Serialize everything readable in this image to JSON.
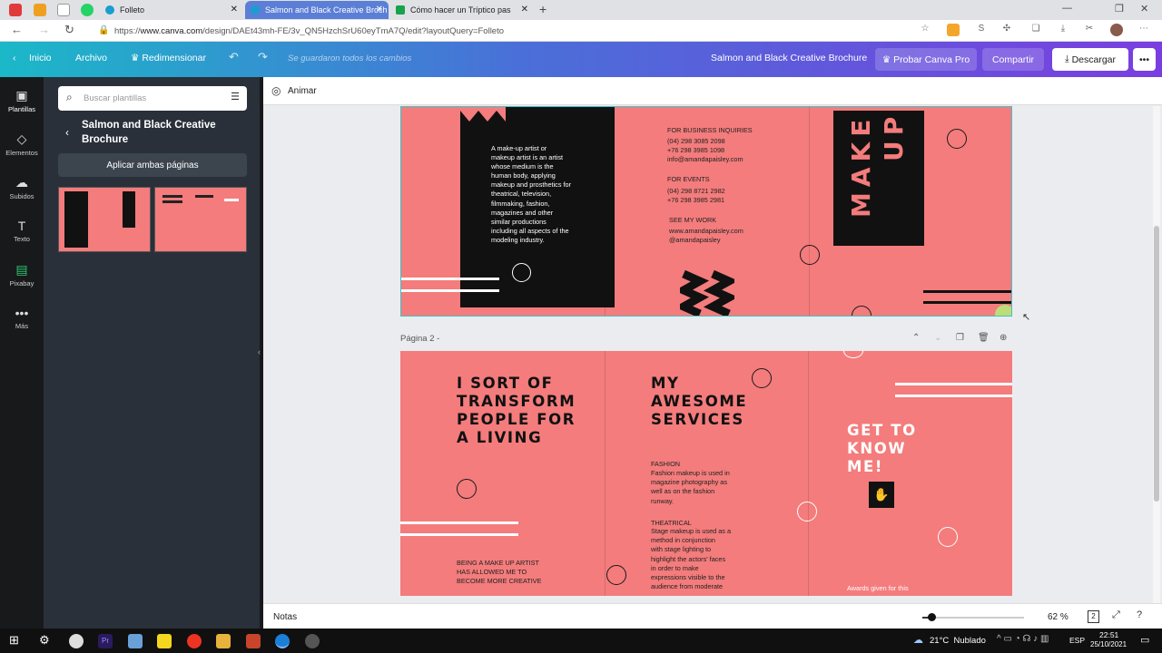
{
  "browser": {
    "tabs": [
      {
        "title": "Folleto",
        "active": false
      },
      {
        "title": "Salmon and Black Creative Broch",
        "active": true
      },
      {
        "title": "Cómo hacer un Tríptico pas",
        "active": false
      }
    ],
    "url_prefix": "https://",
    "url_domain": "www.canva.com",
    "url_path": "/design/DAEt43mh-FE/3v_QN5HzchSrU60eyTmA7Q/edit?layoutQuery=Folleto"
  },
  "canva_header": {
    "home": "Inicio",
    "file": "Archivo",
    "resize": "Redimensionar",
    "saved_status": "Se guardaron todos los cambios",
    "design_title": "Salmon and Black Creative Brochure",
    "try_pro": "Probar Canva Pro",
    "share": "Compartir",
    "download": "Descargar",
    "more": "•••"
  },
  "rail": [
    {
      "label": "Plantillas",
      "icon": "▣"
    },
    {
      "label": "Elementos",
      "icon": "◇"
    },
    {
      "label": "Subidos",
      "icon": "☁"
    },
    {
      "label": "Texto",
      "icon": "T"
    },
    {
      "label": "Pixabay",
      "icon": "▤"
    },
    {
      "label": "Más",
      "icon": "•••"
    }
  ],
  "panel": {
    "search_placeholder": "Buscar plantillas",
    "template_title": "Salmon and Black Creative Brochure",
    "apply_both": "Aplicar ambas páginas"
  },
  "editor": {
    "animate": "Animar",
    "page2_label": "Página 2 -",
    "page1": {
      "black_panel_text": "A make-up artist or\nmakeup artist is an artist\nwhose medium is the\nhuman body, applying\nmakeup and prosthetics for\ntheatrical, television,\nfilmmaking, fashion,\nmagazines and other\nsimilar productions\nincluding all aspects of the\nmodeling industry.",
      "business_heading": "FOR BUSINESS INQUIRIES",
      "business_lines": "(04) 298 3085 2098\n+76 298 3985 1098\ninfo@amandapaisley.com",
      "events_heading": "FOR EVENTS",
      "events_lines": "(04) 298 8721 2982\n+76 298 3985 2981",
      "work_heading": "SEE MY WORK",
      "work_lines": "www.amandapaisley.com\n@amandapaisley",
      "vertical_title_1": "MAKE",
      "vertical_title_2": "UP"
    },
    "page2": {
      "headline_1": "I SORT OF\nTRANSFORM\nPEOPLE FOR\nA LIVING",
      "footer_1": "BEING A MAKE UP ARTIST\nHAS ALLOWED ME TO\nBECOME MORE CREATIVE",
      "headline_2": "MY\nAWESOME\nSERVICES",
      "service_1_title": "FASHION",
      "service_1_body": "Fashion makeup is used in\nmagazine photography as\nwell as on the fashion\nrunway.",
      "service_2_title": "THEATRICAL",
      "service_2_body": "Stage makeup is used as a\nmethod in conjunction\nwith stage lighting to\nhighlight the actors' faces\nin order to make\nexpressions visible to the\naudience from moderate",
      "headline_3": "GET TO\nKNOW\nME!",
      "awards": "Awards given for this"
    }
  },
  "bottom_bar": {
    "notes": "Notas",
    "zoom": "62 %",
    "page_count": "2"
  },
  "taskbar": {
    "weather": "21°C  Nublado",
    "lang": "ESP",
    "time": "22:51",
    "date": "25/10/2021"
  },
  "colors": {
    "salmon": "#f47c7c",
    "ink": "#111111",
    "canva_purple": "#7d2ae8"
  }
}
